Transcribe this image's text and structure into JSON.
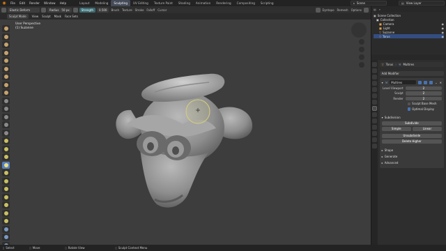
{
  "menu": [
    "File",
    "Edit",
    "Render",
    "Window",
    "Help"
  ],
  "workspaces": [
    "Layout",
    "Modeling",
    "Sculpting",
    "UV Editing",
    "Texture Paint",
    "Shading",
    "Animation",
    "Rendering",
    "Compositing",
    "Scripting"
  ],
  "active_workspace": "Sculpting",
  "scene": "Scene",
  "view_layer": "View Layer",
  "toolbar": {
    "brush_name": "Elastic Deform",
    "radius_label": "Radius",
    "radius_value": "50 px",
    "strength_label": "Strength",
    "strength_value": "0.500",
    "brush": "Brush",
    "texture": "Texture",
    "stroke": "Stroke",
    "falloff": "Falloff",
    "cursor": "Cursor",
    "symmetry": "Dyntopo",
    "remesh": "Remesh",
    "options": "Options"
  },
  "header2": {
    "mode": "Sculpt Mode",
    "items": [
      "View",
      "Sculpt",
      "Mask",
      "Face Sets"
    ]
  },
  "viewport": {
    "line1": "User Perspective",
    "line2": "(1) Suzanne"
  },
  "outliner": {
    "title": "Scene Collection",
    "rows": [
      {
        "label": "Collection",
        "color": "#d8d8d8"
      },
      {
        "label": "Camera",
        "color": "#e0a050"
      },
      {
        "label": "Light",
        "color": "#e0a050"
      },
      {
        "label": "Suzanne",
        "color": "#e0a050"
      },
      {
        "label": "Torus",
        "color": "#e0a050"
      }
    ]
  },
  "properties": {
    "object": "Torus",
    "modifier_type": "Multires",
    "add_modifier": "Add Modifier",
    "modifier_name": "Multires",
    "levels": [
      {
        "label": "Level Viewport",
        "value": "2"
      },
      {
        "label": "Sculpt",
        "value": "2"
      },
      {
        "label": "Render",
        "value": "2"
      }
    ],
    "sculpt_base_mesh": "Sculpt Base Mesh",
    "optimal_display": "Optimal Display",
    "subdivision": "Subdivision",
    "subdivide": "Subdivide",
    "simple": "Simple",
    "linear": "Linear",
    "unsubdivide": "Unsubdivide",
    "delete_higher": "Delete Higher",
    "shape": "Shape",
    "generate": "Generate",
    "advanced": "Advanced"
  },
  "status": {
    "select": "Select",
    "move": "Move",
    "rotate": "Rotate View",
    "context": "Sculpt Context Menu"
  },
  "colors": {
    "accent": "#4772b3",
    "workspace_active": "#444a57",
    "viewport_bg": "#3d3d3d",
    "brush_circle": "#d8cf7a"
  }
}
